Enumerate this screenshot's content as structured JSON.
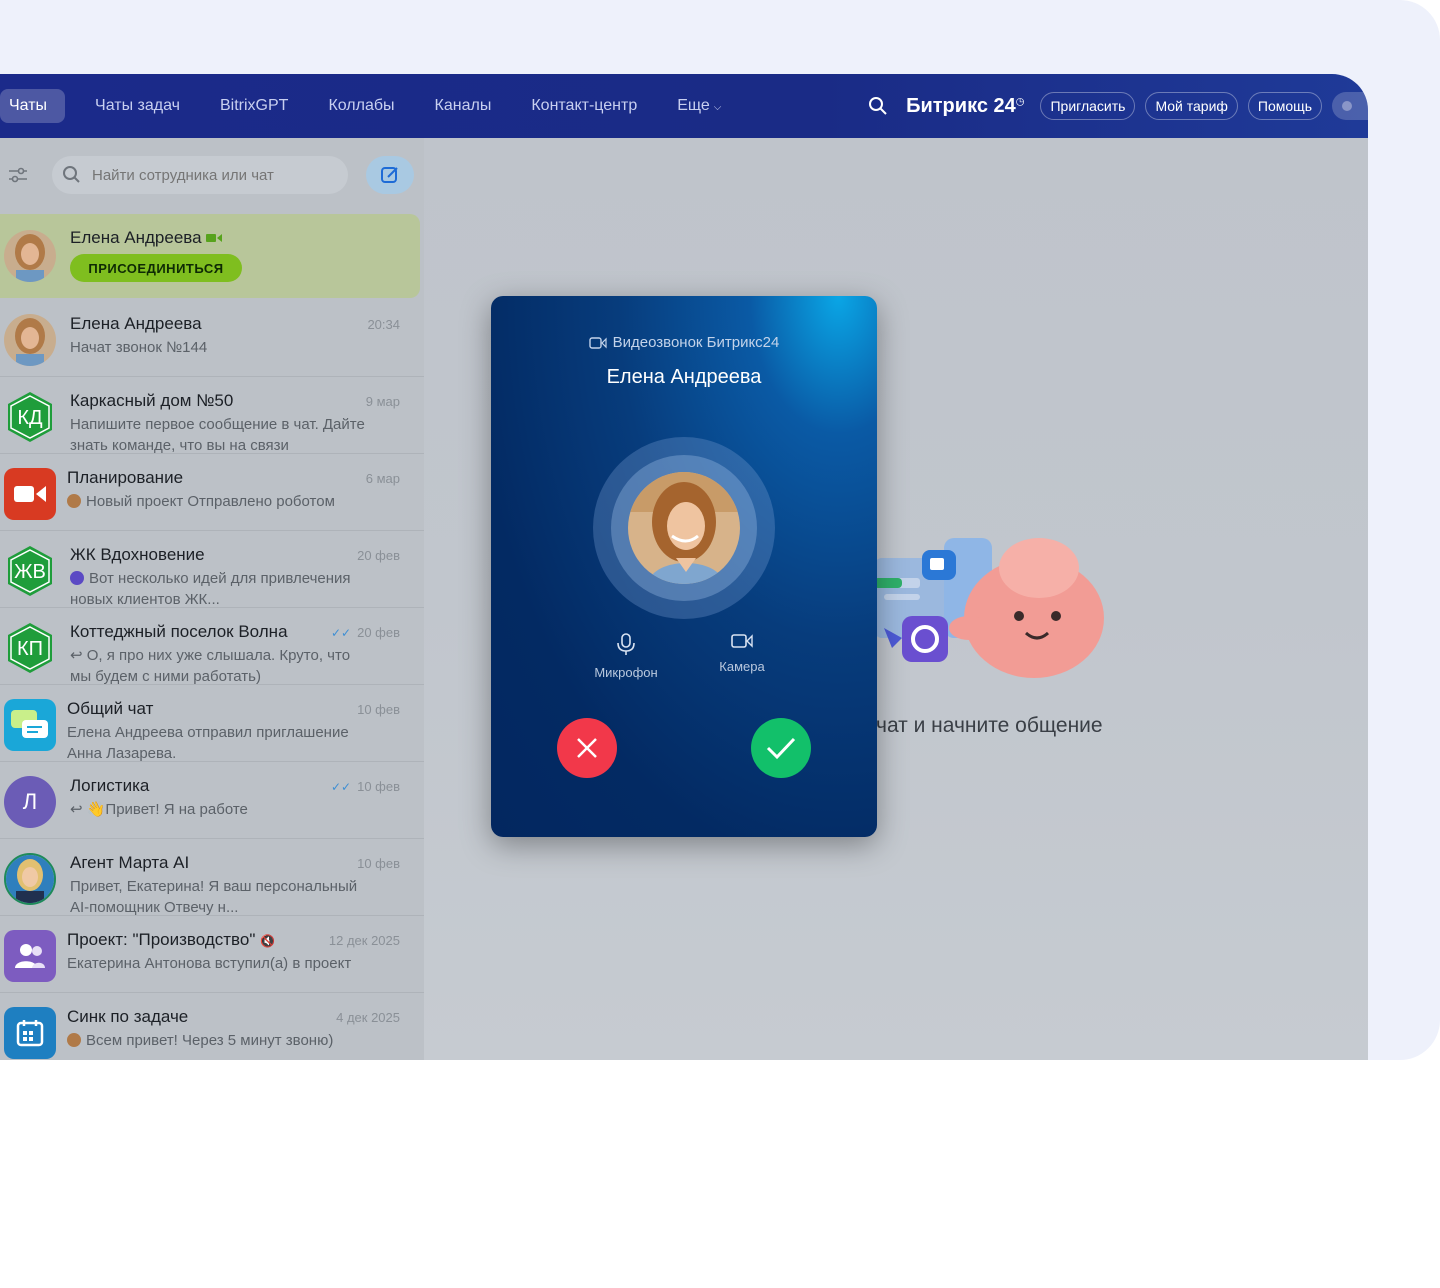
{
  "nav": {
    "tabs": [
      "Чаты",
      "Чаты задач",
      "BitrixGPT",
      "Коллабы",
      "Каналы",
      "Контакт-центр",
      "Еще"
    ],
    "brand": "Битрикс 24",
    "invite": "Пригласить",
    "tariff": "Мой тариф",
    "help": "Помощь"
  },
  "search": {
    "placeholder": "Найти сотрудника или чат"
  },
  "chats": [
    {
      "title": "Елена Андреева",
      "join": "ПРИСОЕДИНИТЬСЯ",
      "avatar": "photo"
    },
    {
      "title": "Елена Андреева",
      "time": "20:34",
      "msg": "Начат звонок №144",
      "avatar": "photo"
    },
    {
      "title": "Каркасный дом №50",
      "time": "9 мар",
      "msg": "Напишите первое сообщение в чат. Дайте знать команде, что вы на связи",
      "initials": "КД"
    },
    {
      "title": "Планирование",
      "time": "6 мар",
      "msg": "Новый проект Отправлено роботом",
      "avatar": "video"
    },
    {
      "title": "ЖК Вдохновение",
      "time": "20 фев",
      "msg": "Вот несколько идей для привлечения новых клиентов ЖК...",
      "initials": "ЖВ"
    },
    {
      "title": "Коттеджный поселок Волна",
      "time": "20 фев",
      "msg": "↩ О, я про них уже слышала. Круто, что мы будем с ними работать)",
      "initials": "КП"
    },
    {
      "title": "Общий чат",
      "time": "10 фев",
      "msg": "Елена Андреева отправил приглашение Анна Лазарева.",
      "avatar": "chat"
    },
    {
      "title": "Логистика",
      "time": "10 фев",
      "msg": "↩ 👋Привет! Я на работе",
      "initials": "Л"
    },
    {
      "title": "Агент Марта AI",
      "time": "10 фев",
      "msg": "Привет, Екатерина! Я ваш персональный AI-помощник Отвечу н...",
      "avatar": "photo2"
    },
    {
      "title": "Проект: \"Производство\"",
      "time": "12 дек 2025",
      "msg": "Екатерина Антонова вступил(а) в проект",
      "avatar": "group"
    },
    {
      "title": "Синк по задаче",
      "time": "4 дек 2025",
      "msg": "Всем привет! Через 5 минут звоню)",
      "avatar": "calendar"
    }
  ],
  "main": {
    "empty_text": "чат и начните общение"
  },
  "call": {
    "header": "Видеозвонок Битрикс24",
    "name": "Елена Андреева",
    "mic_label": "Микрофон",
    "camera_label": "Камера"
  },
  "colors": {
    "topbar": "#1b2a8a",
    "accept": "#12c06a",
    "decline": "#f2384a",
    "join": "#7fbe1f"
  }
}
